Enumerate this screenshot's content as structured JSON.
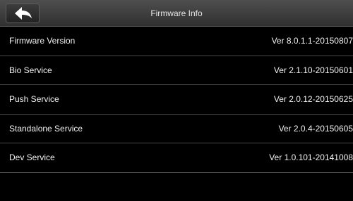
{
  "header": {
    "title": "Firmware Info",
    "back_icon": "arrow-left-icon"
  },
  "rows": [
    {
      "label": "Firmware Version",
      "value": "Ver 8.0.1.1-20150807"
    },
    {
      "label": "Bio Service",
      "value": "Ver 2.1.10-20150601"
    },
    {
      "label": "Push Service",
      "value": "Ver 2.0.12-20150625"
    },
    {
      "label": "Standalone Service",
      "value": "Ver 2.0.4-20150605"
    },
    {
      "label": "Dev Service",
      "value": "Ver 1.0.101-20141008"
    }
  ]
}
